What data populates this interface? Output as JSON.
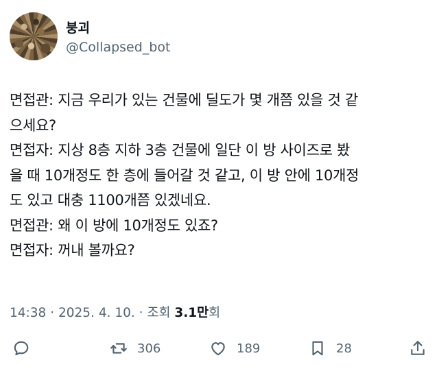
{
  "author": {
    "display_name": "붕괴",
    "handle": "@Collapsed_bot"
  },
  "tweet": {
    "lines": [
      "면접관: 지금 우리가 있는 건물에 딜도가 몇 개쯤 있을 것 같",
      "으세요?",
      "면접자: 지상 8층 지하 3층 건물에 일단 이 방 사이즈로 봤",
      "을 때 10개정도 한 층에 들어갈 것 같고, 이 방 안에 10개정",
      "도 있고 대충 1100개쯤 있겠네요.",
      "면접관: 왜 이 방에 10개정도 있죠?",
      "면접자: 꺼내 볼까요?"
    ]
  },
  "meta": {
    "time": "14:38",
    "separator": " · ",
    "date": "2025. 4. 10.",
    "views_prefix": "조회 ",
    "views_count": "3.1만",
    "views_suffix": "회"
  },
  "actions": {
    "reply": {
      "icon": "reply-icon",
      "count": ""
    },
    "retweet": {
      "icon": "retweet-icon",
      "count": "306"
    },
    "like": {
      "icon": "heart-icon",
      "count": "189"
    },
    "bookmark": {
      "icon": "bookmark-icon",
      "count": "28"
    },
    "share": {
      "icon": "share-icon",
      "count": ""
    }
  }
}
